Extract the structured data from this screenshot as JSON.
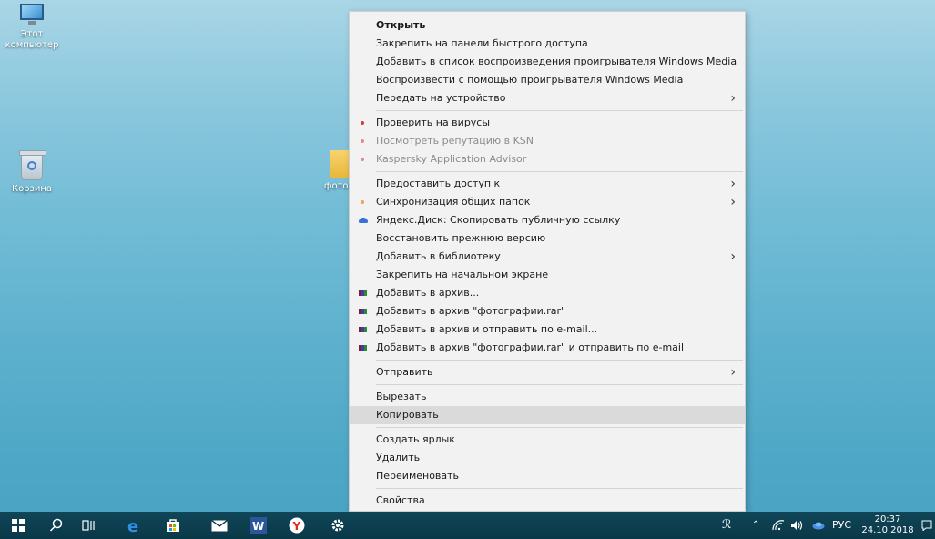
{
  "desktop": {
    "icons": [
      {
        "label": "Этот компьютер",
        "icon": "computer-icon"
      },
      {
        "label": "Корзина",
        "icon": "recycle-bin-icon"
      },
      {
        "label": "фотогр",
        "icon": "folder-icon"
      }
    ]
  },
  "context_menu": {
    "items": [
      {
        "label": "Открыть"
      },
      {
        "label": "Закрепить на панели быстрого доступа"
      },
      {
        "label": "Добавить в список воспроизведения проигрывателя Windows Media"
      },
      {
        "label": "Воспроизвести с помощью проигрывателя Windows Media"
      },
      {
        "label": "Передать на устройство"
      },
      {
        "label": "Проверить на вирусы"
      },
      {
        "label": "Посмотреть репутацию в KSN"
      },
      {
        "label": "Kaspersky Application Advisor"
      },
      {
        "label": "Предоставить доступ к"
      },
      {
        "label": "Синхронизация общих папок"
      },
      {
        "label": "Яндекс.Диск: Скопировать публичную ссылку"
      },
      {
        "label": "Восстановить прежнюю версию"
      },
      {
        "label": "Добавить в библиотеку"
      },
      {
        "label": "Закрепить на начальном экране"
      },
      {
        "label": "Добавить в архив..."
      },
      {
        "label": "Добавить в архив \"фотографии.rar\""
      },
      {
        "label": "Добавить в архив и отправить по e-mail..."
      },
      {
        "label": "Добавить в архив \"фотографии.rar\" и отправить по e-mail"
      },
      {
        "label": "Отправить"
      },
      {
        "label": "Вырезать"
      },
      {
        "label": "Копировать"
      },
      {
        "label": "Создать ярлык"
      },
      {
        "label": "Удалить"
      },
      {
        "label": "Переименовать"
      },
      {
        "label": "Свойства"
      }
    ],
    "submenu_arrow": "›"
  },
  "taskbar": {
    "language": "РУС",
    "time": "20:37",
    "date": "24.10.2018",
    "icons": [
      "windows-start-icon",
      "search-icon",
      "task-view-icon",
      "edge-icon",
      "store-icon",
      "mail-icon",
      "word-icon",
      "yandex-browser-icon",
      "settings-icon"
    ]
  }
}
